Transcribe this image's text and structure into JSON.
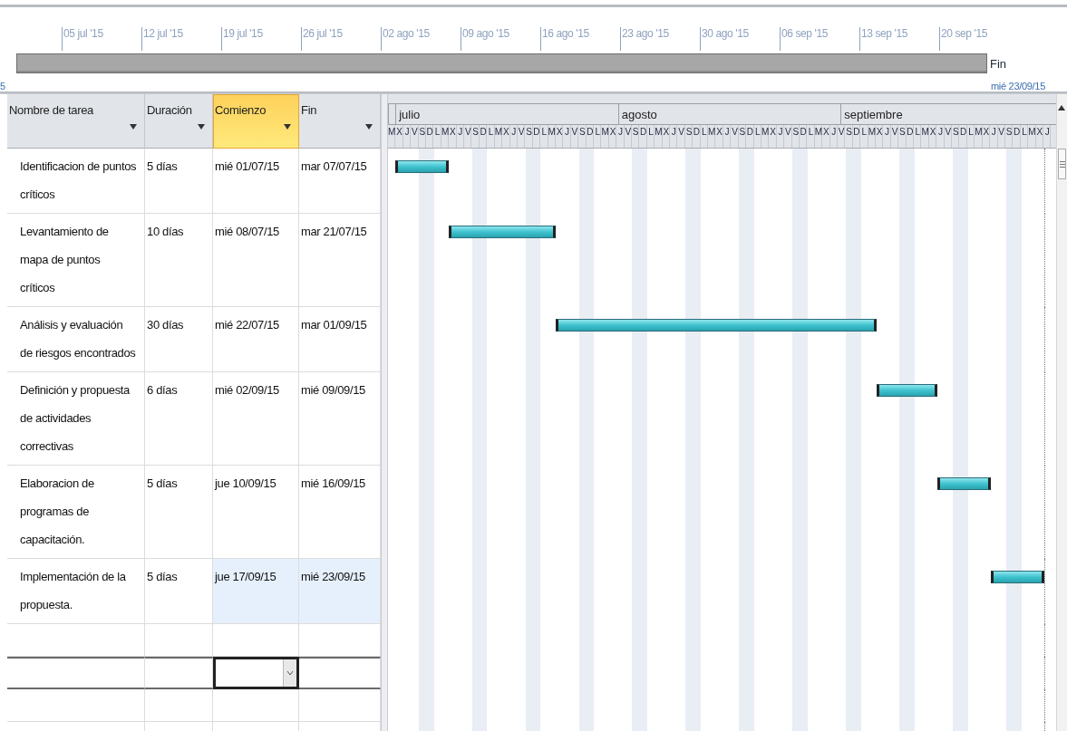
{
  "timeline": {
    "start_date_partial": "5",
    "ticks": [
      "05 jul '15",
      "12 jul '15",
      "19 jul '15",
      "26 jul '15",
      "02 ago '15",
      "09 ago '15",
      "16 ago '15",
      "23 ago '15",
      "30 ago '15",
      "06 sep '15",
      "13 sep '15",
      "20 sep '15"
    ],
    "end_label": "Fin",
    "end_date": "mié 23/09/15"
  },
  "table": {
    "columns": [
      {
        "label": "Nombre de tarea",
        "selected": false
      },
      {
        "label": "Duración",
        "selected": false
      },
      {
        "label": "Comienzo",
        "selected": true
      },
      {
        "label": "Fin",
        "selected": false
      }
    ],
    "rows": [
      {
        "name": "Identificacion de puntos críticos",
        "duration": "5 días",
        "start": "mié 01/07/15",
        "end": "mar 07/07/15",
        "selected": false
      },
      {
        "name": "Levantamiento de mapa de puntos críticos",
        "duration": "10 días",
        "start": "mié 08/07/15",
        "end": "mar 21/07/15",
        "selected": false
      },
      {
        "name": "Análisis y evaluación de riesgos encontrados",
        "duration": "30 días",
        "start": "mié 22/07/15",
        "end": "mar 01/09/15",
        "selected": false
      },
      {
        "name": "Definición y propuesta de actividades correctivas",
        "duration": "6 días",
        "start": "mié 02/09/15",
        "end": "mié 09/09/15",
        "selected": false
      },
      {
        "name": "Elaboracion de programas de capacitación.",
        "duration": "5 días",
        "start": "jue 10/09/15",
        "end": "mié 16/09/15",
        "selected": false
      },
      {
        "name": "Implementación de la propuesta.",
        "duration": "5 días",
        "start": "jue 17/09/15",
        "end": "mié 23/09/15",
        "selected": true
      }
    ],
    "empty_rows": [
      {
        "active": false
      },
      {
        "active": true
      },
      {
        "active": false
      },
      {
        "active": false
      }
    ]
  },
  "gantt": {
    "months": [
      "julio",
      "agosto",
      "septiembre"
    ],
    "days": [
      "M",
      "X",
      "J",
      "V",
      "S",
      "D",
      "L",
      "M",
      "X",
      "J",
      "V",
      "S",
      "D",
      "L",
      "M",
      "X",
      "J",
      "V",
      "S",
      "D",
      "L",
      "M",
      "X",
      "J",
      "V",
      "S",
      "D",
      "L",
      "M",
      "X",
      "J",
      "V",
      "S",
      "D",
      "L",
      "M",
      "X",
      "J",
      "V",
      "S",
      "D",
      "L",
      "M",
      "X",
      "J",
      "V",
      "S",
      "D",
      "L",
      "M",
      "X",
      "J",
      "V",
      "S",
      "D",
      "L",
      "M",
      "X",
      "J",
      "V",
      "S",
      "D",
      "L",
      "M",
      "X",
      "J",
      "V",
      "S",
      "D",
      "L",
      "M",
      "X",
      "J",
      "V",
      "S",
      "D",
      "L",
      "M",
      "X",
      "J",
      "V",
      "S",
      "D",
      "L",
      "M",
      "X",
      "J"
    ]
  }
}
